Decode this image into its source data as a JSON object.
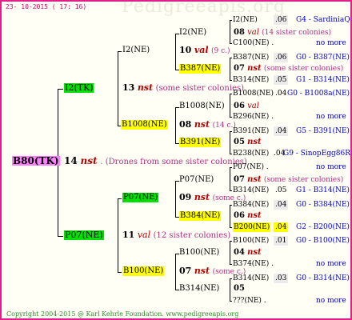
{
  "header": {
    "date": "23- 10-2015 ( 17: 16)",
    "watermark": "Pedigreeapis.org"
  },
  "root": {
    "name": "B80(TK)",
    "year": "14",
    "mating": "nst",
    "note": ". (Drones from some sister colonies)"
  },
  "g2": [
    {
      "name": "I2(TK)",
      "year": "13",
      "mating": "nst",
      "note": " (some sister colonies)"
    },
    {
      "name": "P07(NE)",
      "year": "11",
      "mating": "val",
      "note": " (12 sister colonies)"
    }
  ],
  "g3": [
    {
      "name": "I2(NE)",
      "year": "10",
      "mating": "val",
      "note": " (9 c.)"
    },
    {
      "name": "B1008(NE)",
      "year": "08",
      "mating": "nst",
      "note": " (14 c.)"
    },
    {
      "name": "P07(NE)",
      "year": "09",
      "mating": "nst",
      "note": " (some c.)"
    },
    {
      "name": "B100(NE)",
      "year": "07",
      "mating": "nst",
      "note": " (some c.)"
    }
  ],
  "g4": [
    {
      "name": "I2(NE)",
      "year": "08",
      "mating": "val",
      "note": " (14 sister colonies)"
    },
    {
      "name": "B387(NE)",
      "year": "07",
      "mating": "nst",
      "note": " (some sister colonies)"
    },
    {
      "name": "B1008(NE)",
      "year": "06",
      "mating": "val"
    },
    {
      "name": "B391(NE)",
      "year": "05",
      "mating": "nst"
    },
    {
      "name": "P07(NE)",
      "year": "07",
      "mating": "nst",
      "note": " (some sister colonies)"
    },
    {
      "name": "B384(NE)",
      "year": "06",
      "mating": "nst"
    },
    {
      "name": "B100(NE)",
      "year": "04",
      "mating": "nst"
    },
    {
      "name": "B314(NE)",
      "year": "05"
    }
  ],
  "g5": [
    {
      "name": "I2(NE)",
      "year": ".06",
      "origin": "G4 - SardiniaQ"
    },
    {
      "name": "C100(NE) .",
      "origin": "no more"
    },
    {
      "name": "B387(NE)",
      "year": ".06",
      "origin": "G0 - B387(NE)"
    },
    {
      "name": "B314(NE)",
      "year": ".05",
      "origin": "G1 - B314(NE)"
    },
    {
      "name": "B1008(NE)",
      "year": ".04",
      "origin": "G0 - B1008a(NE)"
    },
    {
      "name": "B296(NE) .",
      "origin": "no more"
    },
    {
      "name": "B391(NE)",
      "year": ".04",
      "origin": "G5 - B391(NE)"
    },
    {
      "name": "B238(NE)",
      "year": ".04",
      "origin": "G9 - SinopEgg86R"
    },
    {
      "name": "P07(NE) .",
      "origin": "no more"
    },
    {
      "name": "B314(NE)",
      "year": ".05",
      "origin": "G1 - B314(NE)"
    },
    {
      "name": "B384(NE)",
      "year": ".04",
      "origin": "G0 - B384(NE)"
    },
    {
      "name": "B200(NE)",
      "year": ".04",
      "origin": "G2 - B200(NE)"
    },
    {
      "name": "B100(NE)",
      "year": ".01",
      "origin": "G0 - B100(NE)"
    },
    {
      "name": "B374(NE) .",
      "origin": "no more"
    },
    {
      "name": "B314(NE)",
      "year": ".03",
      "origin": "G0 - B314(NE)"
    },
    {
      "name": "???(NE) .",
      "origin": "no more"
    }
  ],
  "footer": {
    "text": "Copyright 2004-2015 @ Karl Kehrle Foundation.   www.pedigreeapis.org"
  }
}
